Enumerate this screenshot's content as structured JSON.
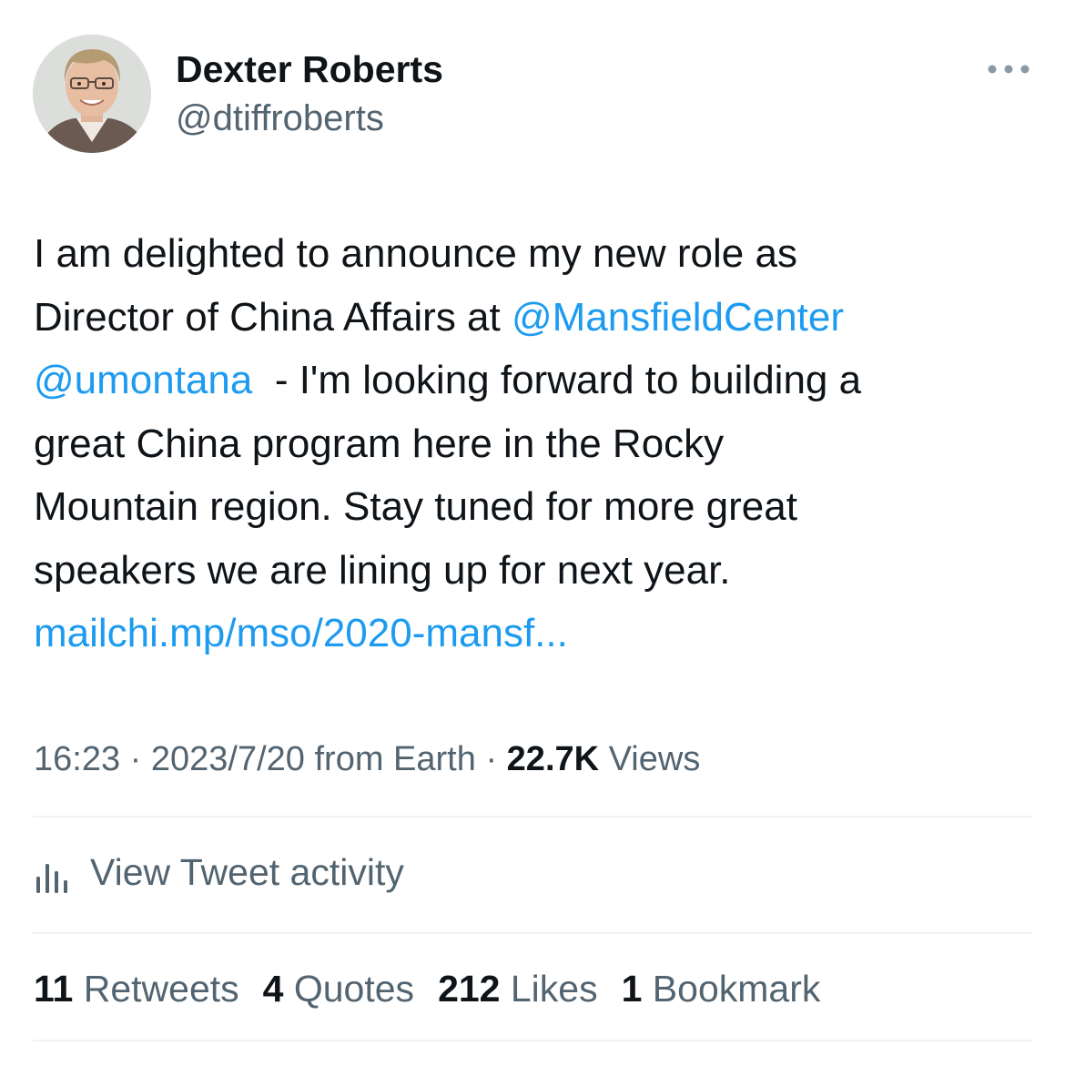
{
  "author": {
    "name": "Dexter Roberts",
    "handle": "@dtiffroberts",
    "avatar_icon": "profile-photo"
  },
  "more_icon": "more-horizontal-icon",
  "tweet": {
    "line1": "I am delighted to announce my new role as",
    "line2_text": "Director of China Affairs at ",
    "mention1": "@MansfieldCenter",
    "mention2": "@umontana",
    "line3_text": "  - I'm looking forward to building a",
    "line4": "great China program here in the Rocky",
    "line5": "Mountain region. Stay tuned for more great",
    "line6": "speakers we are lining up for next year.",
    "link": "mailchi.mp/mso/2020-mansf..."
  },
  "meta": {
    "time": "16:23",
    "sep1": " · ",
    "date": "2023/7/20",
    "source": " from Earth",
    "sep2": " · ",
    "views_count": "22.7K",
    "views_label": " Views"
  },
  "activity": {
    "label": "View Tweet activity",
    "icon": "analytics-bar-icon"
  },
  "stats": {
    "retweets_count": "11",
    "retweets_label": " Retweets",
    "quotes_count": "4",
    "quotes_label": " Quotes",
    "likes_count": "212",
    "likes_label": " Likes",
    "bookmarks_count": "1",
    "bookmarks_label": " Bookmark"
  },
  "colors": {
    "link": "#1d9bf0",
    "text_primary": "#0f1419",
    "text_secondary": "#536471",
    "divider": "#eff3f4"
  }
}
